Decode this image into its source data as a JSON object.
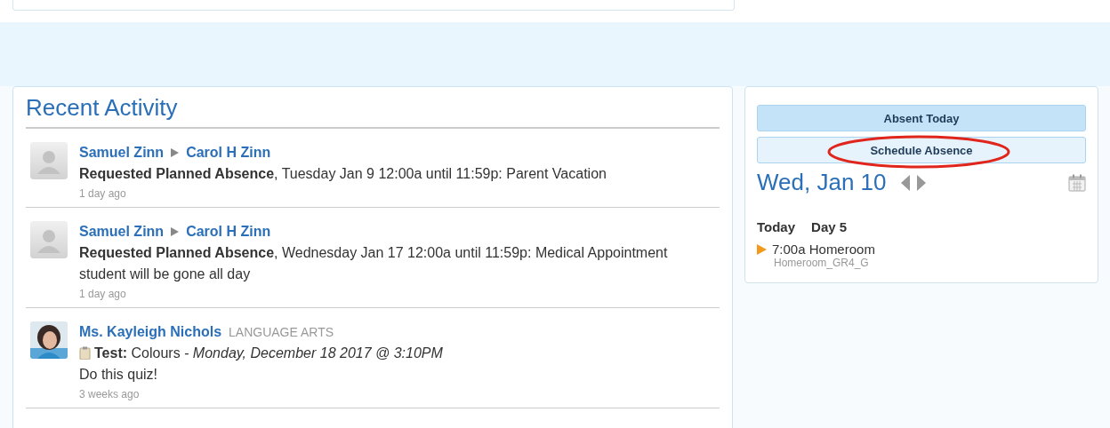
{
  "recent_activity": {
    "title": "Recent Activity",
    "items": [
      {
        "kind": "absence",
        "from": "Samuel Zinn",
        "to": "Carol H Zinn",
        "text": "**Requested Planned Absence**, Tuesday Jan 9 12:00a until 11:59p: Parent Vacation",
        "time": "1 day ago"
      },
      {
        "kind": "absence",
        "from": "Samuel Zinn",
        "to": "Carol H Zinn",
        "text": "**Requested Planned Absence**, Wednesday Jan 17 12:00a until 11:59p: Medical Appointment student will be gone all day",
        "time": "1 day ago"
      },
      {
        "kind": "post",
        "from": "Ms. Kayleigh Nichols",
        "course": "LANGUAGE ARTS",
        "label": "Test:",
        "title": "Colours",
        "date": "- Monday, December 18 2017 @ 3:10PM",
        "text": "Do this quiz!",
        "time": "3 weeks ago"
      }
    ]
  },
  "schedule": {
    "buttons": [
      {
        "label": "Absent Today",
        "selected": true
      },
      {
        "label": "Schedule Absence",
        "selected": false,
        "circled": true
      }
    ],
    "date": "Wed, Jan 10",
    "today": "Today",
    "day": "Day 5",
    "events": [
      {
        "time_title": "7:00a Homeroom",
        "section": "Homeroom_GR4_G"
      }
    ]
  }
}
